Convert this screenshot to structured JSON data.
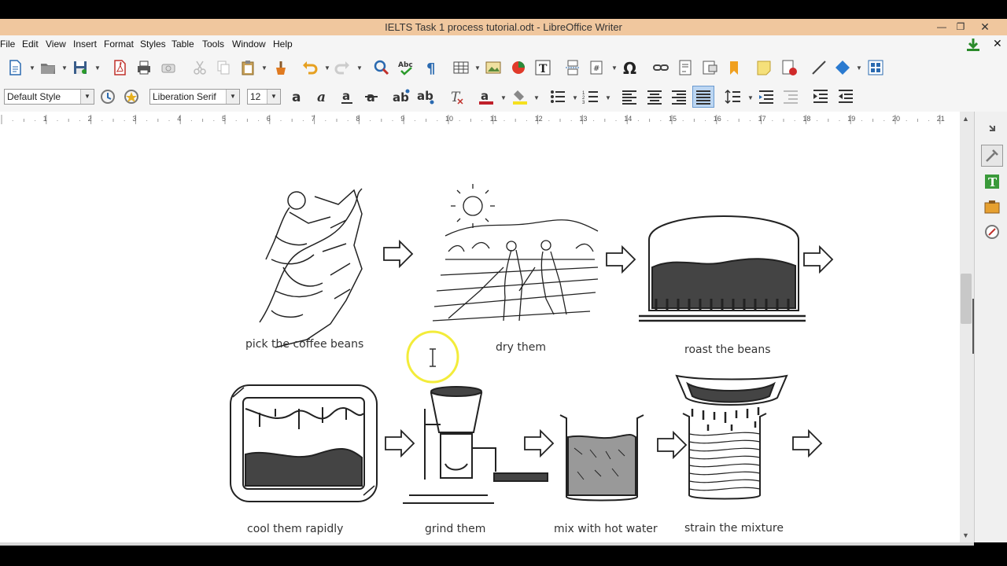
{
  "window": {
    "title": "IELTS Task 1 process tutorial.odt - LibreOffice Writer"
  },
  "menu": [
    "File",
    "Edit",
    "View",
    "Insert",
    "Format",
    "Styles",
    "Table",
    "Tools",
    "Window",
    "Help"
  ],
  "format": {
    "paragraph_style": "Default Style",
    "font_name": "Liberation Serif",
    "font_size": "12"
  },
  "ruler": {
    "numbers": [
      "1",
      "2",
      "3",
      "4",
      "5",
      "6",
      "7",
      "8",
      "9",
      "10",
      "11",
      "12",
      "13",
      "14",
      "15",
      "16",
      "17",
      "18",
      "19",
      "20",
      "21"
    ]
  },
  "diagram": {
    "steps": [
      "pick the coffee beans",
      "dry them",
      "roast the beans",
      "cool them rapidly",
      "grind them",
      "mix with hot water",
      "strain the mixture"
    ]
  },
  "colors": {
    "titlebar": "#f0c79e",
    "highlight_ring": "#f3ec3a"
  }
}
